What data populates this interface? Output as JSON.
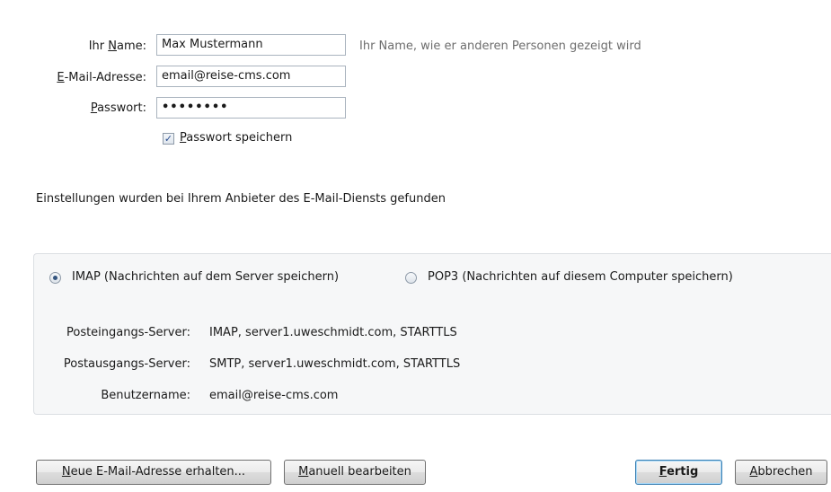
{
  "form": {
    "name_label_prefix": "Ihr ",
    "name_label_key": "N",
    "name_label_rest": "ame:",
    "name_value": "Max Mustermann",
    "name_hint": "Ihr Name, wie er anderen Personen gezeigt wird",
    "email_label_key": "E",
    "email_label_rest": "-Mail-Adresse:",
    "email_value": "email@reise-cms.com",
    "password_label_key": "P",
    "password_label_rest": "asswort:",
    "password_value": "••••••••",
    "save_password_checked": true,
    "save_password_key": "P",
    "save_password_rest": "asswort speichern"
  },
  "status_text": "Einstellungen wurden bei Ihrem Anbieter des E-Mail-Diensts gefunden",
  "protocol": {
    "selected": "imap",
    "imap_label": "IMAP (Nachrichten auf dem Server speichern)",
    "pop3_label": "POP3 (Nachrichten auf diesem Computer speichern)"
  },
  "servers": {
    "incoming_label": "Posteingangs-Server:",
    "incoming_value": "IMAP, server1.uweschmidt.com, STARTTLS",
    "outgoing_label": "Postausgangs-Server:",
    "outgoing_value": "SMTP, server1.uweschmidt.com, STARTTLS",
    "username_label": "Benutzername:",
    "username_value": "email@reise-cms.com"
  },
  "buttons": {
    "new_address_key": "N",
    "new_address_rest": "eue E-Mail-Adresse erhalten...",
    "manual_key": "M",
    "manual_rest": "anuell bearbeiten",
    "done_key": "F",
    "done_rest": "ertig",
    "cancel_key": "A",
    "cancel_rest": "bbrechen"
  }
}
